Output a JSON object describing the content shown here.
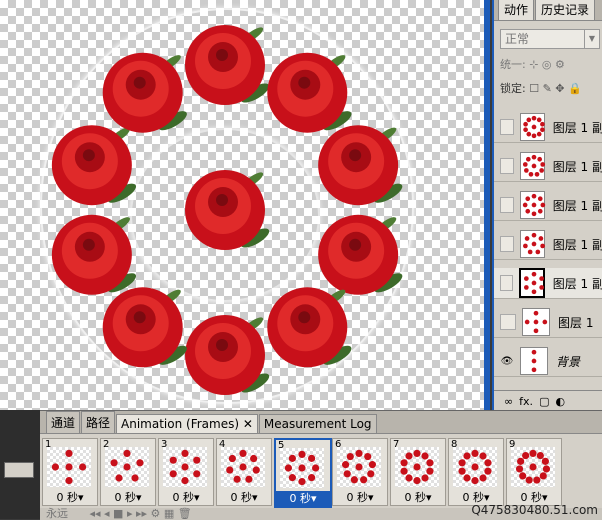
{
  "panels": {
    "tabs": [
      "动作",
      "历史记录"
    ],
    "blend_mode": "正常",
    "unify_label": "统一:",
    "lock_label": "锁定:",
    "layers": [
      {
        "name": "图层 1 副",
        "visible": false,
        "selected": false
      },
      {
        "name": "图层 1 副",
        "visible": false,
        "selected": false
      },
      {
        "name": "图层 1 副",
        "visible": false,
        "selected": false
      },
      {
        "name": "图层 1 副",
        "visible": false,
        "selected": false
      },
      {
        "name": "图层 1 副",
        "visible": false,
        "selected": true
      },
      {
        "name": "图层 1",
        "visible": false,
        "selected": false
      },
      {
        "name": "背景",
        "visible": true,
        "selected": false
      }
    ],
    "footer_icons": [
      "link-icon",
      "fx-icon",
      "mask-icon",
      "adjustment-icon"
    ],
    "footer_fx": "fx."
  },
  "animation": {
    "tabs": [
      "通道",
      "路径",
      "Animation (Frames)",
      "Measurement Log"
    ],
    "active_tab": "Animation (Frames)",
    "frames": [
      {
        "number": "1",
        "delay": "0 秒▾",
        "roses": 4
      },
      {
        "number": "2",
        "delay": "0 秒▾",
        "roses": 5
      },
      {
        "number": "3",
        "delay": "0 秒▾",
        "roses": 6
      },
      {
        "number": "4",
        "delay": "0 秒▾",
        "roses": 7
      },
      {
        "number": "5",
        "delay": "0 秒▾",
        "roses": 8
      },
      {
        "number": "6",
        "delay": "0 秒▾",
        "roses": 9
      },
      {
        "number": "7",
        "delay": "0 秒▾",
        "roses": 10
      },
      {
        "number": "8",
        "delay": "0 秒▾",
        "roses": 10
      },
      {
        "number": "9",
        "delay": "0 秒▾",
        "roses": 11
      }
    ],
    "selected_frame": 5,
    "loop_option": "永远"
  },
  "watermark": "Q475830480.51.com",
  "colors": {
    "rose": "#c8101a",
    "selection": "#1c5bb8"
  }
}
